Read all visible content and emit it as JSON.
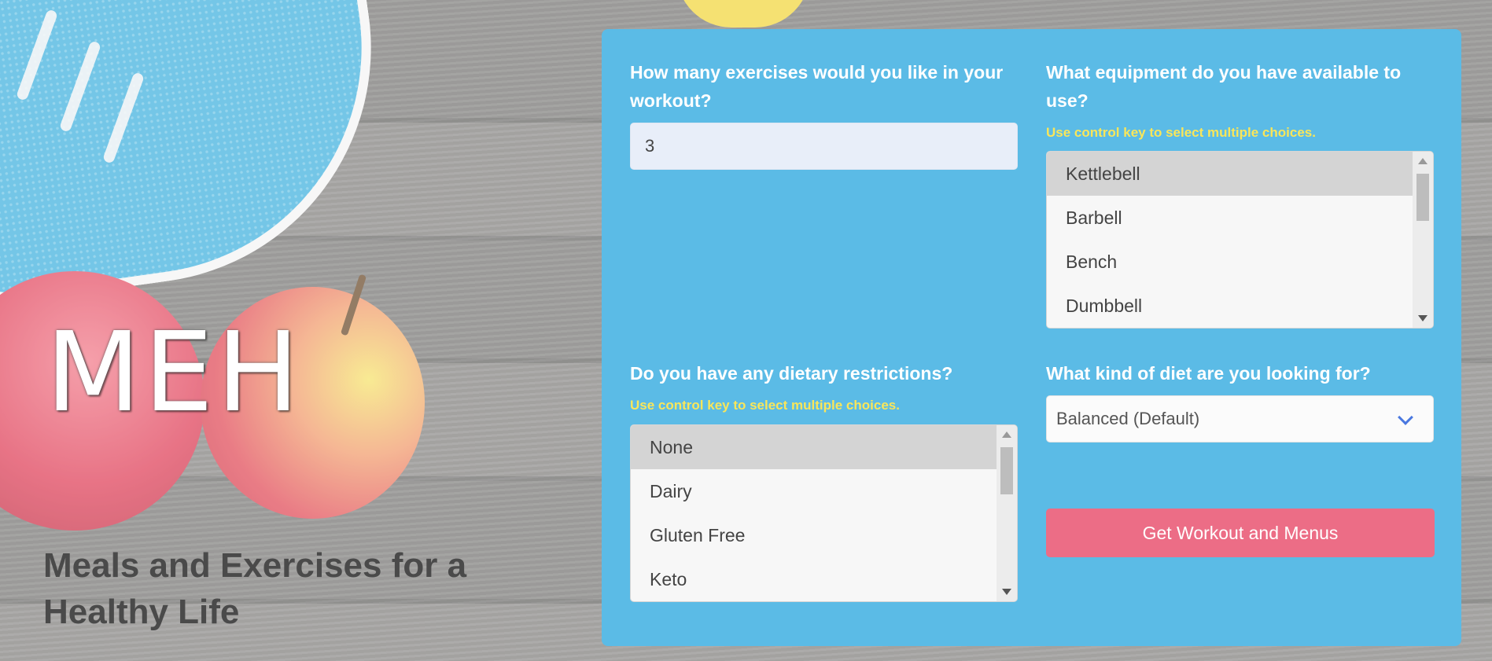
{
  "hero": {
    "title": "MEH",
    "subtitle": "Meals and Exercises for a Healthy Life"
  },
  "form": {
    "exercises": {
      "label": "How many exercises would you like in your workout?",
      "value": "3"
    },
    "equipment": {
      "label": "What equipment do you have available to use?",
      "hint": "Use control key to select multiple choices.",
      "options": [
        "Kettlebell",
        "Barbell",
        "Bench",
        "Dumbbell"
      ],
      "selected": "Kettlebell"
    },
    "restrictions": {
      "label": "Do you have any dietary restrictions?",
      "hint": "Use control key to select multiple choices.",
      "options": [
        "None",
        "Dairy",
        "Gluten Free",
        "Keto"
      ],
      "selected": "None"
    },
    "diet": {
      "label": "What kind of diet are you looking for?",
      "value": "Balanced (Default)"
    },
    "submit_label": "Get Workout and Menus"
  },
  "colors": {
    "panel": "#5bbbe6",
    "hint": "#f9e65a",
    "button": "#ec6d86",
    "chevron": "#4a78e0"
  }
}
